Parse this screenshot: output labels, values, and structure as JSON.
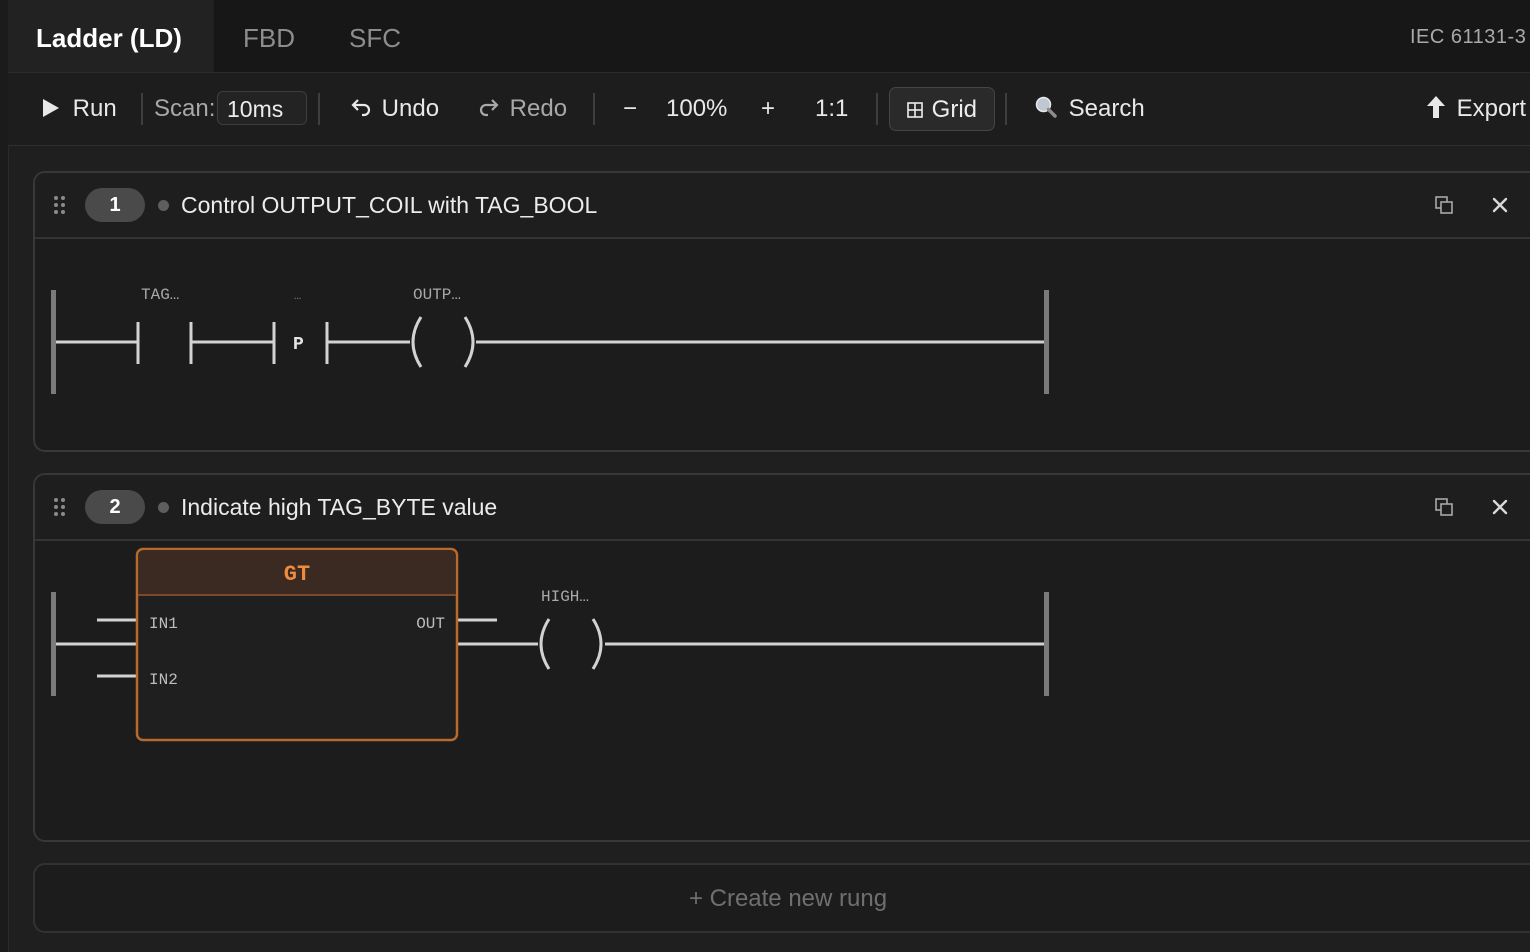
{
  "tabs": [
    {
      "label": "Ladder (LD)",
      "active": true
    },
    {
      "label": "FBD",
      "active": false
    },
    {
      "label": "SFC",
      "active": false
    }
  ],
  "standard_label": "IEC 61131-3",
  "toolbar": {
    "run_label": "Run",
    "scan_label": "Scan:",
    "scan_value": "10ms",
    "undo_label": "Undo",
    "redo_label": "Redo",
    "zoom_out": "−",
    "zoom_level": "100%",
    "zoom_in": "+",
    "zoom_reset": "1:1",
    "grid_label": "Grid",
    "search_label": "Search",
    "export_label": "Export"
  },
  "rungs": [
    {
      "number": "1",
      "title": "Control OUTPUT_COIL with TAG_BOOL",
      "contact1_label": "TAG…",
      "contact2_label": "…",
      "contact2_type": "P",
      "coil_label": "OUTP…"
    },
    {
      "number": "2",
      "title": "Indicate high TAG_BYTE value",
      "block_name": "GT",
      "block_inputs": [
        "IN1",
        "IN2"
      ],
      "block_output": "OUT",
      "coil_label": "HIGH…"
    }
  ],
  "create_rung_label": "+ Create new rung",
  "colors": {
    "block_accent": "#b8692c",
    "block_title": "#f08a3c",
    "wire": "#d2d2d2",
    "rail": "#7a7a7a"
  }
}
